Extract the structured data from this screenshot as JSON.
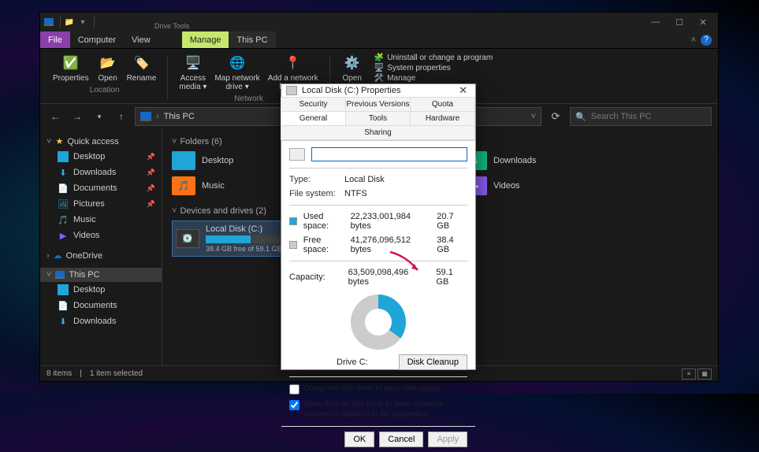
{
  "window": {
    "title": "This PC",
    "menu": {
      "file": "File",
      "computer": "Computer",
      "view": "View",
      "drivetools": "Drive Tools",
      "manage": "Manage"
    },
    "ribbon": {
      "properties": "Properties",
      "open": "Open",
      "rename": "Rename",
      "access": "Access media",
      "mapdrive": "Map network drive",
      "addloc": "Add a network location",
      "opensettings": "Open Settings",
      "group_location": "Location",
      "group_network": "Network",
      "side_uninstall": "Uninstall or change a program",
      "side_sysprop": "System properties",
      "side_manage": "Manage"
    },
    "address": "This PC",
    "search_placeholder": "Search This PC",
    "sidebar": {
      "quick": "Quick access",
      "desktop": "Desktop",
      "downloads": "Downloads",
      "documents": "Documents",
      "pictures": "Pictures",
      "music": "Music",
      "videos": "Videos",
      "onedrive": "OneDrive",
      "thispc": "This PC"
    },
    "content": {
      "folders_head": "Folders (6)",
      "folders": [
        "Desktop",
        "Music",
        "Downloads",
        "Videos"
      ],
      "drives_head": "Devices and drives (2)",
      "drive_name": "Local Disk (C:)",
      "drive_free": "38.4 GB free of 59.1 GB"
    },
    "status": {
      "items": "8 items",
      "selected": "1 item selected"
    }
  },
  "dialog": {
    "title": "Local Disk (C:) Properties",
    "tabs_top": [
      "Security",
      "Previous Versions",
      "Quota"
    ],
    "tabs_bottom": [
      "General",
      "Tools",
      "Hardware",
      "Sharing"
    ],
    "type_label": "Type:",
    "type_value": "Local Disk",
    "fs_label": "File system:",
    "fs_value": "NTFS",
    "used_label": "Used space:",
    "used_bytes": "22,233,001,984 bytes",
    "used_gb": "20.7 GB",
    "free_label": "Free space:",
    "free_bytes": "41,276,096,512 bytes",
    "free_gb": "38.4 GB",
    "cap_label": "Capacity:",
    "cap_bytes": "63,509,098,496 bytes",
    "cap_gb": "59.1 GB",
    "drive_label": "Drive C:",
    "cleanup": "Disk Cleanup",
    "compress": "Compress this drive to save disk space",
    "index": "Allow files on this drive to have contents indexed in addition to file properties",
    "ok": "OK",
    "cancel": "Cancel",
    "apply": "Apply"
  }
}
